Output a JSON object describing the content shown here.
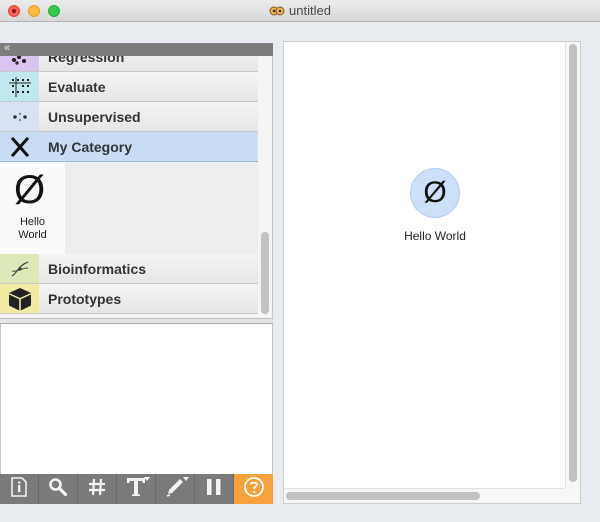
{
  "window": {
    "title": "untitled",
    "title_icon": "orange-icon"
  },
  "dock": {
    "collapse_icon": "double-chevron-left-icon",
    "categories": [
      {
        "label": "Regression",
        "icon": "regression-icon",
        "color": "#d9c3ef"
      },
      {
        "label": "Evaluate",
        "icon": "evaluate-icon",
        "color": "#bfe9ee"
      },
      {
        "label": "Unsupervised",
        "icon": "unsupervised-icon",
        "color": "#d7e3f2"
      },
      {
        "label": "My Category",
        "icon": "x-icon",
        "color": "#c9dcf4",
        "selected": true
      },
      {
        "label": "Bioinformatics",
        "icon": "bioinformatics-icon",
        "color": "#dde9b6"
      },
      {
        "label": "Prototypes",
        "icon": "cube-icon",
        "color": "#f1eaa3"
      }
    ],
    "widget": {
      "glyph": "Ø",
      "label_line1": "Hello",
      "label_line2": "World"
    }
  },
  "toolbar": {
    "tools": [
      {
        "name": "info",
        "icon": "info-icon"
      },
      {
        "name": "search",
        "icon": "search-icon"
      },
      {
        "name": "grid",
        "icon": "hash-icon"
      },
      {
        "name": "text",
        "icon": "text-icon"
      },
      {
        "name": "draw",
        "icon": "pen-icon"
      },
      {
        "name": "pause",
        "icon": "pause-icon"
      },
      {
        "name": "help",
        "icon": "help-icon",
        "active": true
      }
    ],
    "active_color": "#f6a13c"
  },
  "canvas": {
    "node": {
      "glyph": "Ø",
      "label": "Hello World",
      "color": "#cde0f7"
    }
  }
}
